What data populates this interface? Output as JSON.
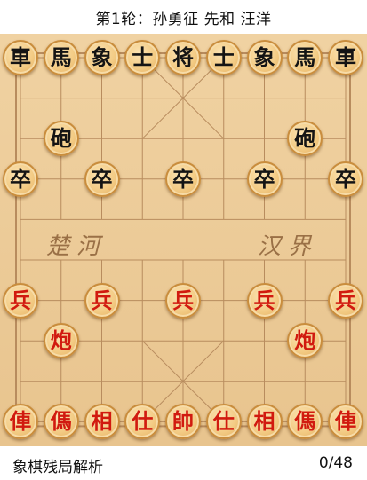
{
  "header": {
    "title": "第1轮：孙勇征 先和 汪洋"
  },
  "board": {
    "river_left": "楚河",
    "river_right": "汉界",
    "pieces": [
      {
        "label": "車",
        "side": "black",
        "file": 0,
        "rank": 0,
        "name": "black-chariot-left"
      },
      {
        "label": "馬",
        "side": "black",
        "file": 1,
        "rank": 0,
        "name": "black-horse-left"
      },
      {
        "label": "象",
        "side": "black",
        "file": 2,
        "rank": 0,
        "name": "black-elephant-left"
      },
      {
        "label": "士",
        "side": "black",
        "file": 3,
        "rank": 0,
        "name": "black-advisor-left"
      },
      {
        "label": "将",
        "side": "black",
        "file": 4,
        "rank": 0,
        "name": "black-general"
      },
      {
        "label": "士",
        "side": "black",
        "file": 5,
        "rank": 0,
        "name": "black-advisor-right"
      },
      {
        "label": "象",
        "side": "black",
        "file": 6,
        "rank": 0,
        "name": "black-elephant-right"
      },
      {
        "label": "馬",
        "side": "black",
        "file": 7,
        "rank": 0,
        "name": "black-horse-right"
      },
      {
        "label": "車",
        "side": "black",
        "file": 8,
        "rank": 0,
        "name": "black-chariot-right"
      },
      {
        "label": "砲",
        "side": "black",
        "file": 1,
        "rank": 2,
        "name": "black-cannon-left"
      },
      {
        "label": "砲",
        "side": "black",
        "file": 7,
        "rank": 2,
        "name": "black-cannon-right"
      },
      {
        "label": "卒",
        "side": "black",
        "file": 0,
        "rank": 3,
        "name": "black-soldier-1"
      },
      {
        "label": "卒",
        "side": "black",
        "file": 2,
        "rank": 3,
        "name": "black-soldier-2"
      },
      {
        "label": "卒",
        "side": "black",
        "file": 4,
        "rank": 3,
        "name": "black-soldier-3"
      },
      {
        "label": "卒",
        "side": "black",
        "file": 6,
        "rank": 3,
        "name": "black-soldier-4"
      },
      {
        "label": "卒",
        "side": "black",
        "file": 8,
        "rank": 3,
        "name": "black-soldier-5"
      },
      {
        "label": "兵",
        "side": "red",
        "file": 0,
        "rank": 6,
        "name": "red-soldier-1"
      },
      {
        "label": "兵",
        "side": "red",
        "file": 2,
        "rank": 6,
        "name": "red-soldier-2"
      },
      {
        "label": "兵",
        "side": "red",
        "file": 4,
        "rank": 6,
        "name": "red-soldier-3"
      },
      {
        "label": "兵",
        "side": "red",
        "file": 6,
        "rank": 6,
        "name": "red-soldier-4"
      },
      {
        "label": "兵",
        "side": "red",
        "file": 8,
        "rank": 6,
        "name": "red-soldier-5"
      },
      {
        "label": "炮",
        "side": "red",
        "file": 1,
        "rank": 7,
        "name": "red-cannon-left"
      },
      {
        "label": "炮",
        "side": "red",
        "file": 7,
        "rank": 7,
        "name": "red-cannon-right"
      },
      {
        "label": "俥",
        "side": "red",
        "file": 0,
        "rank": 9,
        "name": "red-chariot-left"
      },
      {
        "label": "傌",
        "side": "red",
        "file": 1,
        "rank": 9,
        "name": "red-horse-left"
      },
      {
        "label": "相",
        "side": "red",
        "file": 2,
        "rank": 9,
        "name": "red-elephant-left"
      },
      {
        "label": "仕",
        "side": "red",
        "file": 3,
        "rank": 9,
        "name": "red-advisor-left"
      },
      {
        "label": "帥",
        "side": "red",
        "file": 4,
        "rank": 9,
        "name": "red-general"
      },
      {
        "label": "仕",
        "side": "red",
        "file": 5,
        "rank": 9,
        "name": "red-advisor-right"
      },
      {
        "label": "相",
        "side": "red",
        "file": 6,
        "rank": 9,
        "name": "red-elephant-right"
      },
      {
        "label": "傌",
        "side": "red",
        "file": 7,
        "rank": 9,
        "name": "red-horse-right"
      },
      {
        "label": "俥",
        "side": "red",
        "file": 8,
        "rank": 9,
        "name": "red-chariot-right"
      }
    ]
  },
  "footer": {
    "app_name": "象棋残局解析",
    "move_counter": "0/48"
  }
}
